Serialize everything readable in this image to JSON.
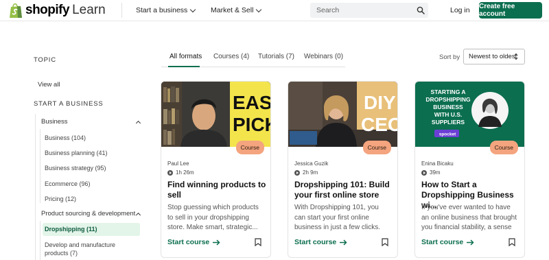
{
  "header": {
    "logo_word": "shopify",
    "logo_learn": "Learn",
    "nav": [
      {
        "label": "Start a business"
      },
      {
        "label": "Market & Sell"
      }
    ],
    "search_placeholder": "Search",
    "login_label": "Log in",
    "cta_label": "Create free account",
    "brand_color": "#0b6e4f"
  },
  "sidebar": {
    "topic_heading": "TOPIC",
    "view_all": "View all",
    "section_heading": "START A BUSINESS",
    "group1": {
      "label": "Business",
      "items": [
        "Business (104)",
        "Business planning (41)",
        "Business strategy (95)",
        "Ecommerce (96)",
        "Pricing (12)"
      ]
    },
    "group2": {
      "label": "Product sourcing & development",
      "active_item": "Dropshipping (11)",
      "items": [
        "Develop and manufacture products (7)"
      ]
    }
  },
  "tabs": [
    {
      "label": "All formats"
    },
    {
      "label": "Courses (4)"
    },
    {
      "label": "Tutorials (7)"
    },
    {
      "label": "Webinars (0)"
    }
  ],
  "sort": {
    "label": "Sort by",
    "value": "Newest to oldest"
  },
  "cards": [
    {
      "badge": "Course",
      "author": "Paul Lee",
      "duration": "1h 26m",
      "title": "Find winning products to sell",
      "description": "Stop guessing which products to sell in your dropshipping store. Make smart, strategic...",
      "cta": "Start course",
      "thumb_text": [
        "EASY",
        "PICK"
      ]
    },
    {
      "badge": "Course",
      "author": "Jessica Guzik",
      "duration": "2h 9m",
      "title": "Dropshipping 101: Build your first online store",
      "description": "With Dropshipping 101, you can start your first online business in just a few clicks. You read th...",
      "cta": "Start course",
      "thumb_text": [
        "DIY",
        "CEO"
      ]
    },
    {
      "badge": "Course",
      "author": "Enina Bicaku",
      "duration": "39m",
      "title": "How to Start a Dropshipping Business wi...",
      "description": "If you've ever wanted to have an online business that brought you financial stability, a sense ...",
      "cta": "Start course",
      "thumb_text": [
        "STARTING A",
        "DROPSHIPPING",
        "BUSINESS",
        "WITH U.S.",
        "SUPPLIERS"
      ],
      "thumb_brand": "spocket"
    }
  ]
}
